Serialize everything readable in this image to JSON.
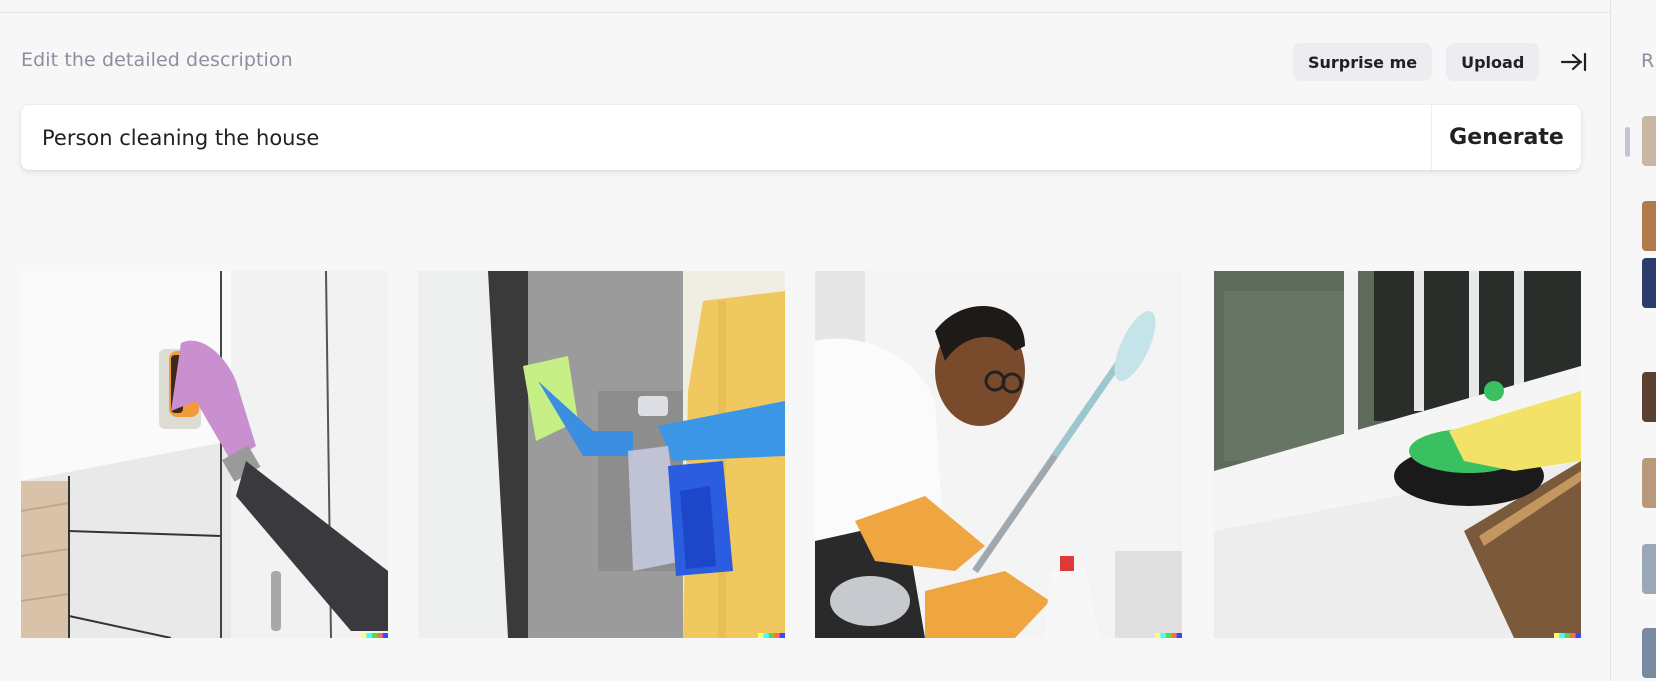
{
  "header": {
    "description_label": "Edit the detailed description",
    "surprise_label": "Surprise me",
    "upload_label": "Upload",
    "collapse_icon": "arrow-right-to-line-icon"
  },
  "prompt": {
    "value": "Person cleaning the house",
    "generate_label": "Generate"
  },
  "gallery": {
    "images": [
      {
        "subject": "gloved hand scrubbing a white wall with a sponge"
      },
      {
        "subject": "person in yellow apron and blue gloves wiping a window with a spray bottle"
      },
      {
        "subject": "man with glasses cleaning a wall with a mop"
      },
      {
        "subject": "yellow-gloved hand cleaning a window sill with a green brush"
      }
    ],
    "watermark_colors": [
      "#ffff66",
      "#42ffff",
      "#51da4c",
      "#ff6e3c",
      "#3c46ff"
    ]
  },
  "sidebar": {
    "title": "R",
    "thumb_count": 7
  },
  "colors": {
    "background": "#f7f7f8",
    "button_bg": "#ececf1",
    "muted_text": "#8e8ea0"
  }
}
